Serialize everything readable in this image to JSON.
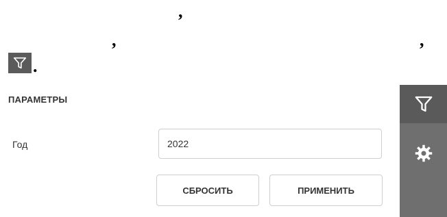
{
  "top_text": {
    "comma_1": ",",
    "comma_2": ",",
    "comma_3": ",",
    "period": "."
  },
  "panel": {
    "title": "ПАРАМЕТРЫ",
    "year_label": "Год",
    "year_value": "2022",
    "reset_label": "СБРОСИТЬ",
    "apply_label": "ПРИМЕНИТЬ"
  },
  "icons": {
    "inline_filter": "filter-icon",
    "rail_filter": "filter-icon",
    "rail_settings": "gear-icon"
  },
  "colors": {
    "icon_box": "#5b5b5b",
    "rail_bg": "#6f6f6f",
    "rail_active": "#5a5a5a",
    "icon_fg": "#ffffff"
  }
}
